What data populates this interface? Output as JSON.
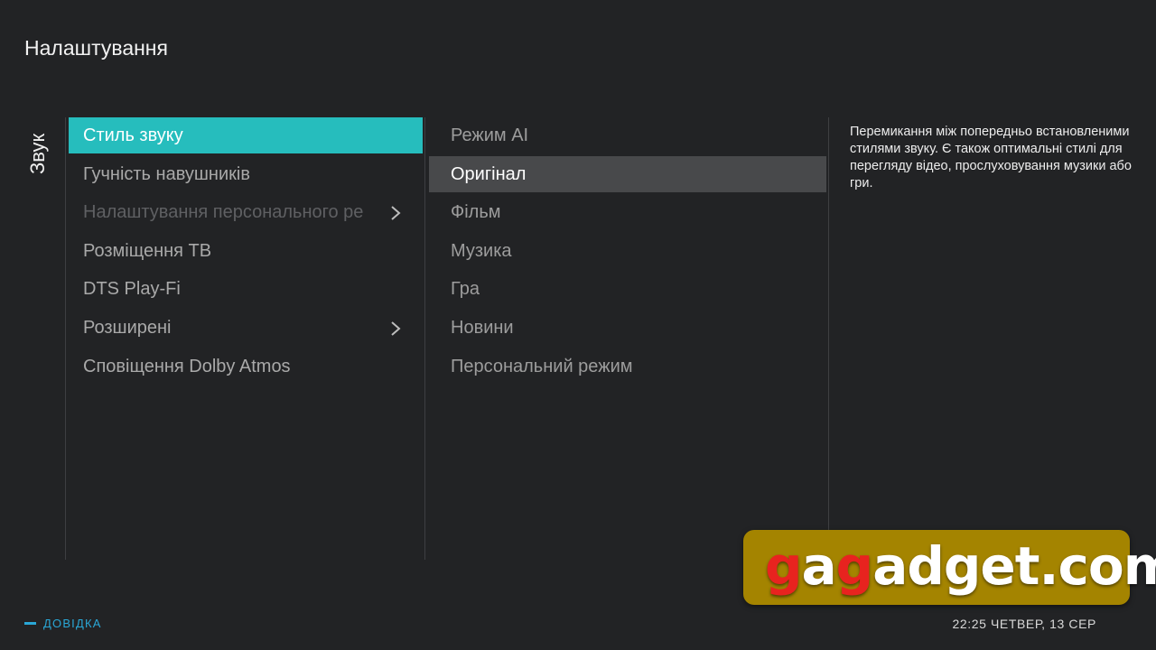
{
  "header": {
    "title": "Налаштування"
  },
  "category": {
    "label": "Звук"
  },
  "menu": {
    "items": [
      {
        "label": "Стиль звуку",
        "state": "selected",
        "submenu": false
      },
      {
        "label": "Гучність навушників",
        "state": "normal",
        "submenu": false
      },
      {
        "label": "Налаштування персонального ре",
        "state": "disabled",
        "submenu": true
      },
      {
        "label": "Розміщення ТВ",
        "state": "normal",
        "submenu": false
      },
      {
        "label": "DTS Play-Fi",
        "state": "normal",
        "submenu": false
      },
      {
        "label": "Розширені",
        "state": "normal",
        "submenu": true
      },
      {
        "label": "Сповіщення Dolby Atmos",
        "state": "normal",
        "submenu": false
      }
    ]
  },
  "options": {
    "items": [
      {
        "label": "Режим AI"
      },
      {
        "label": "Оригінал"
      },
      {
        "label": "Фільм"
      },
      {
        "label": "Музика"
      },
      {
        "label": "Гра"
      },
      {
        "label": "Новини"
      },
      {
        "label": "Персональний режим"
      }
    ],
    "current": "Оригінал"
  },
  "description": "Перемикання між попередньо встановленими стилями звуку. Є також оптимальні стилі для перегляду відео, прослуховування музики або гри.",
  "footer": {
    "help_label": "ДОВІДКА",
    "clock": "22:25 ЧЕТВЕР, 13 СЕР"
  },
  "watermark": {
    "text": "gagadget.com"
  },
  "colors": {
    "background": "#222325",
    "selected": "#26bdbd",
    "current_option": "#48494b",
    "help": "#2aa7d6",
    "watermark_bg": "#a48400",
    "watermark_accent": "#e8231f"
  }
}
